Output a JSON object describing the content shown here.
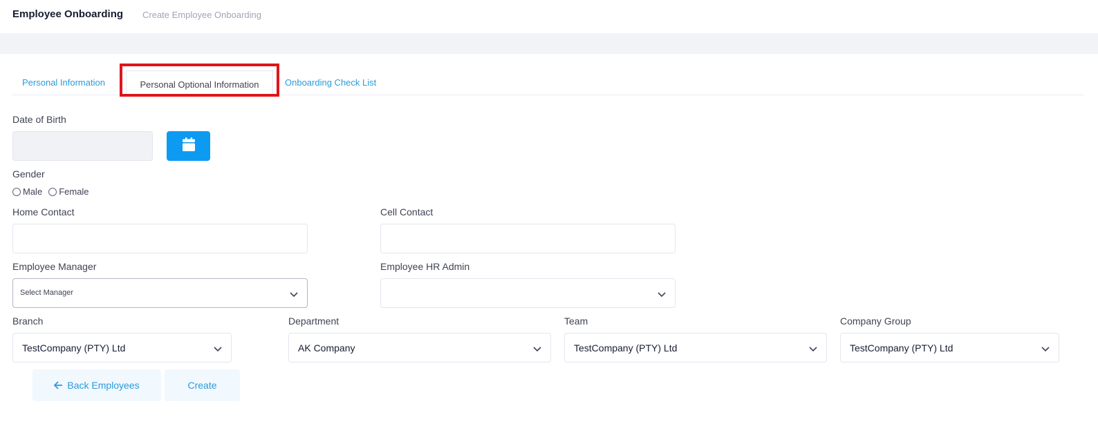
{
  "header": {
    "title": "Employee Onboarding",
    "subtitle": "Create Employee Onboarding"
  },
  "tabs": [
    {
      "label": "Personal Information"
    },
    {
      "label": "Personal Optional Information",
      "active": true
    },
    {
      "label": "Onboarding Check List"
    }
  ],
  "form": {
    "dob_label": "Date of Birth",
    "dob_value": "",
    "gender_label": "Gender",
    "gender_options": [
      "Male",
      "Female"
    ],
    "home_contact_label": "Home Contact",
    "home_contact_value": "",
    "cell_contact_label": "Cell Contact",
    "cell_contact_value": "",
    "manager_label": "Employee Manager",
    "manager_value": "Select Manager",
    "hr_admin_label": "Employee HR Admin",
    "hr_admin_value": "",
    "branch_label": "Branch",
    "branch_value": "TestCompany (PTY) Ltd",
    "department_label": "Department",
    "department_value": "AK Company",
    "team_label": "Team",
    "team_value": "TestCompany (PTY) Ltd",
    "company_group_label": "Company Group",
    "company_group_value": "TestCompany (PTY) Ltd"
  },
  "buttons": {
    "back_label": "Back Employees",
    "create_label": "Create"
  },
  "colors": {
    "accent": "#2a9bdb",
    "calendar_button": "#0d9bf2",
    "highlight": "#e0141b"
  }
}
